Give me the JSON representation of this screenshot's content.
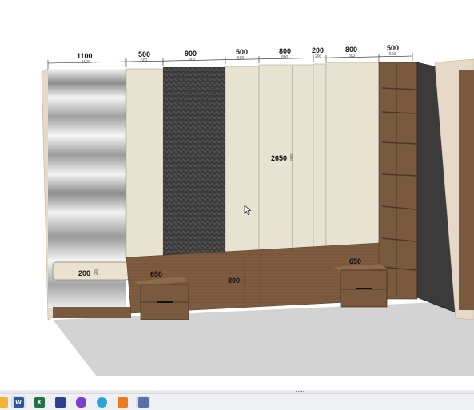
{
  "dimensions_top": [
    {
      "value": "1100",
      "sub": "1100"
    },
    {
      "value": "500",
      "sub": "500"
    },
    {
      "value": "900",
      "sub": "900"
    },
    {
      "value": "500",
      "sub": "500"
    },
    {
      "value": "800",
      "sub": "800"
    },
    {
      "value": "200",
      "sub": "200"
    },
    {
      "value": "800",
      "sub": "800"
    },
    {
      "value": "500",
      "sub": "500"
    }
  ],
  "dimensions_inner": {
    "height_panel": "2650",
    "height_panel_sub": "2650",
    "left_shelf": "200",
    "left_shelf_sub": "200",
    "nightstand_left": "650",
    "nightstand_right": "650",
    "lower_panel": "800",
    "lower_panel_sub": "800"
  },
  "colors": {
    "cream": "#e7e1cf",
    "wood": "#7a5a3e",
    "dark_panel": "#3a3a3a",
    "floor": "#d3d3d3"
  },
  "taskbar": {
    "icons": [
      {
        "name": "explorer-icon",
        "label": "",
        "color": "#f2b632"
      },
      {
        "name": "word-icon",
        "label": "W",
        "color": "#2b579a"
      },
      {
        "name": "excel-icon",
        "label": "X",
        "color": "#217346"
      },
      {
        "name": "app-blue-icon",
        "label": "",
        "color": "#2d3f8e"
      },
      {
        "name": "shield-app-icon",
        "label": "",
        "color": "#7a3fd0"
      },
      {
        "name": "telegram-icon",
        "label": "",
        "color": "#2aa3de"
      },
      {
        "name": "orange-app-icon",
        "label": "",
        "color": "#f07a1a"
      },
      {
        "name": "settings-app-icon",
        "label": "",
        "color": "#5a6ea8"
      }
    ]
  }
}
